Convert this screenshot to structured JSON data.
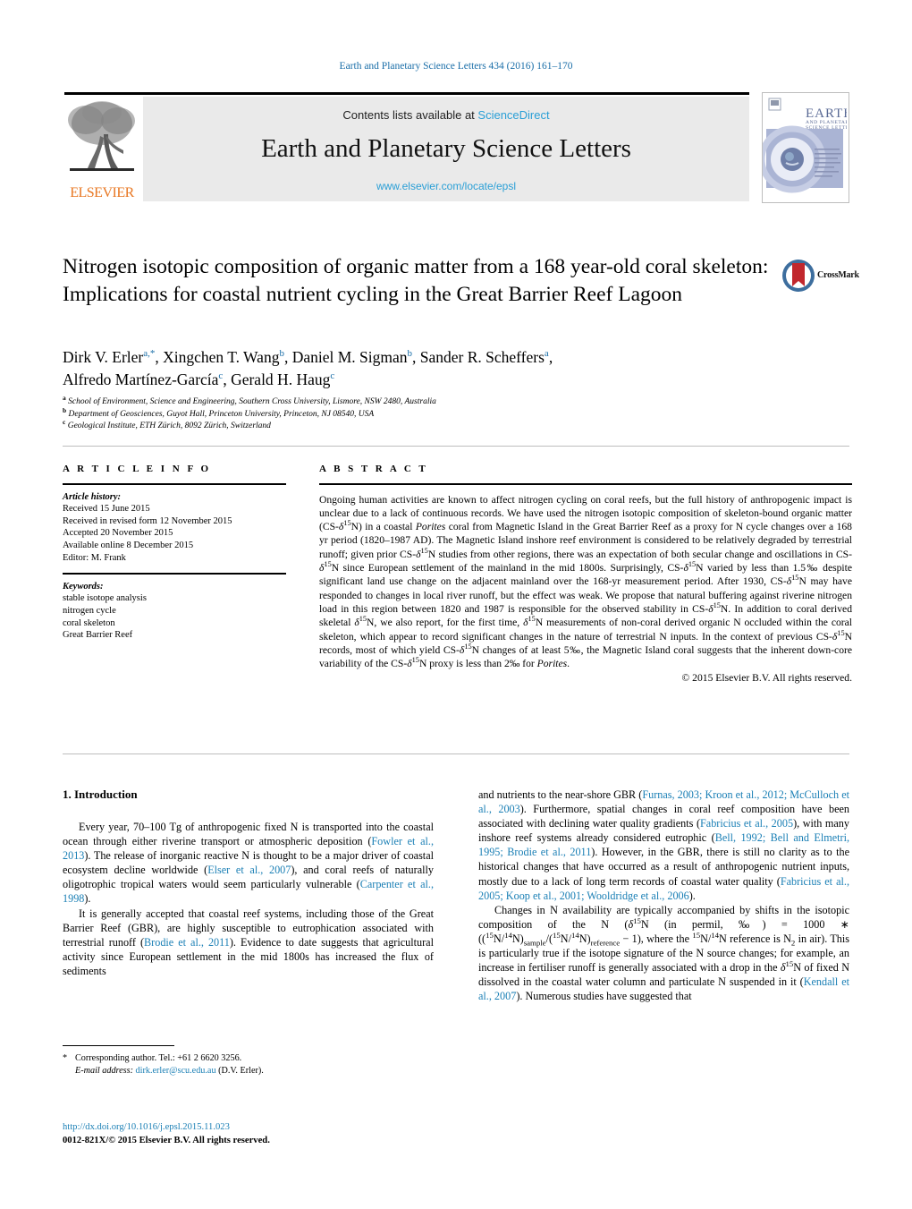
{
  "running_head": "Earth and Planetary Science Letters 434 (2016) 161–170",
  "masthead": {
    "contents_prefix": "Contents lists available at ",
    "contents_link": "ScienceDirect",
    "journal_title": "Earth and Planetary Science Letters",
    "journal_url": "www.elsevier.com/locate/epsl",
    "publisher_name": "ELSEVIER",
    "cover_title_line1": "EARTH",
    "cover_title_line2": "AND PLANETARY",
    "cover_title_line3": "SCIENCE LETTERS"
  },
  "crossmark": {
    "label": "CrossMark"
  },
  "title": "Nitrogen isotopic composition of organic matter from a 168 year-old coral skeleton: Implications for coastal nutrient cycling in the Great Barrier Reef Lagoon",
  "authors": [
    {
      "name": "Dirk V. Erler",
      "marks": "a,*"
    },
    {
      "name": "Xingchen T. Wang",
      "marks": "b"
    },
    {
      "name": "Daniel M. Sigman",
      "marks": "b"
    },
    {
      "name": "Sander R. Scheffers",
      "marks": "a"
    },
    {
      "name": "Alfredo Martínez-García",
      "marks": "c"
    },
    {
      "name": "Gerald H. Haug",
      "marks": "c"
    }
  ],
  "affiliations": [
    {
      "mark": "a",
      "text": "School of Environment, Science and Engineering, Southern Cross University, Lismore, NSW 2480, Australia"
    },
    {
      "mark": "b",
      "text": "Department of Geosciences, Guyot Hall, Princeton University, Princeton, NJ 08540, USA"
    },
    {
      "mark": "c",
      "text": "Geological Institute, ETH Zürich, 8092 Zürich, Switzerland"
    }
  ],
  "article_info": {
    "heading": "A R T I C L E    I N F O",
    "history_label": "Article history:",
    "history": [
      "Received 15 June 2015",
      "Received in revised form 12 November 2015",
      "Accepted 20 November 2015",
      "Available online 8 December 2015",
      "Editor: M. Frank"
    ],
    "keywords_label": "Keywords:",
    "keywords": [
      "stable isotope analysis",
      "nitrogen cycle",
      "coral skeleton",
      "Great Barrier Reef"
    ]
  },
  "abstract": {
    "heading": "A B S T R A C T",
    "paragraphs": [
      "Ongoing human activities are known to affect nitrogen cycling on coral reefs, but the full history of anthropogenic impact is unclear due to a lack of continuous records. We have used the nitrogen isotopic composition of skeleton-bound organic matter (CS-δ15N) in a coastal Porites coral from Magnetic Island in the Great Barrier Reef as a proxy for N cycle changes over a 168 yr period (1820–1987 AD). The Magnetic Island inshore reef environment is considered to be relatively degraded by terrestrial runoff; given prior CS-δ15N studies from other regions, there was an expectation of both secular change and oscillations in CS-δ15N since European settlement of the mainland in the mid 1800s. Surprisingly, CS-δ15N varied by less than 1.5‰ despite significant land use change on the adjacent mainland over the 168-yr measurement period. After 1930, CS-δ15N may have responded to changes in local river runoff, but the effect was weak. We propose that natural buffering against riverine nitrogen load in this region between 1820 and 1987 is responsible for the observed stability in CS-δ15N. In addition to coral derived skeletal δ15N, we also report, for the first time, δ15N measurements of non-coral derived organic N occluded within the coral skeleton, which appear to record significant changes in the nature of terrestrial N inputs. In the context of previous CS-δ15N records, most of which yield CS-δ15N changes of at least 5‰, the Magnetic Island coral suggests that the inherent down-core variability of the CS-δ15N proxy is less than 2‰ for Porites."
    ],
    "copyright": "© 2015 Elsevier B.V. All rights reserved."
  },
  "body": {
    "section_title": "1. Introduction",
    "left_paragraphs": [
      "Every year, 70–100 Tg of anthropogenic fixed N is transported into the coastal ocean through either riverine transport or atmospheric deposition (Fowler et al., 2013). The release of inorganic reactive N is thought to be a major driver of coastal ecosystem decline worldwide (Elser et al., 2007), and coral reefs of naturally oligotrophic tropical waters would seem particularly vulnerable (Carpenter et al., 1998).",
      "It is generally accepted that coastal reef systems, including those of the Great Barrier Reef (GBR), are highly susceptible to eutrophication associated with terrestrial runoff (Brodie et al., 2011). Evidence to date suggests that agricultural activity since European settlement in the mid 1800s has increased the flux of sediments"
    ],
    "right_paragraphs": [
      "and nutrients to the near-shore GBR (Furnas, 2003; Kroon et al., 2012; McCulloch et al., 2003). Furthermore, spatial changes in coral reef composition have been associated with declining water quality gradients (Fabricius et al., 2005), with many inshore reef systems already considered eutrophic (Bell, 1992; Bell and Elmetri, 1995; Brodie et al., 2011). However, in the GBR, there is still no clarity as to the historical changes that have occurred as a result of anthropogenic nutrient inputs, mostly due to a lack of long term records of coastal water quality (Fabricius et al., 2005; Koop et al., 2001; Wooldridge et al., 2006).",
      "Changes in N availability are typically accompanied by shifts in the isotopic composition of the N (δ15N (in permil, ‰) = 1000 * ((15N/14N)sample/(15N/14N)reference − 1), where the 15N/14N reference is N2 in air). This is particularly true if the isotope signature of the N source changes; for example, an increase in fertiliser runoff is generally associated with a drop in the δ15N of fixed N dissolved in the coastal water column and particulate N suspended in it (Kendall et al., 2007). Numerous studies have suggested that"
    ]
  },
  "footnote": {
    "corresponding": "Corresponding author. Tel.: +61 2 6620 3256.",
    "email_label": "E-mail address:",
    "email": "dirk.erler@scu.edu.au",
    "email_suffix": "(D.V. Erler)."
  },
  "doi": {
    "url": "http://dx.doi.org/10.1016/j.epsl.2015.11.023",
    "issn_line": "0012-821X/© 2015 Elsevier B.V. All rights reserved."
  },
  "colors": {
    "link_blue": "#1a7fb5",
    "sciencedirect_blue": "#2a9fd6",
    "elsevier_orange": "#E87722",
    "panel_gray": "#eaeaea"
  }
}
